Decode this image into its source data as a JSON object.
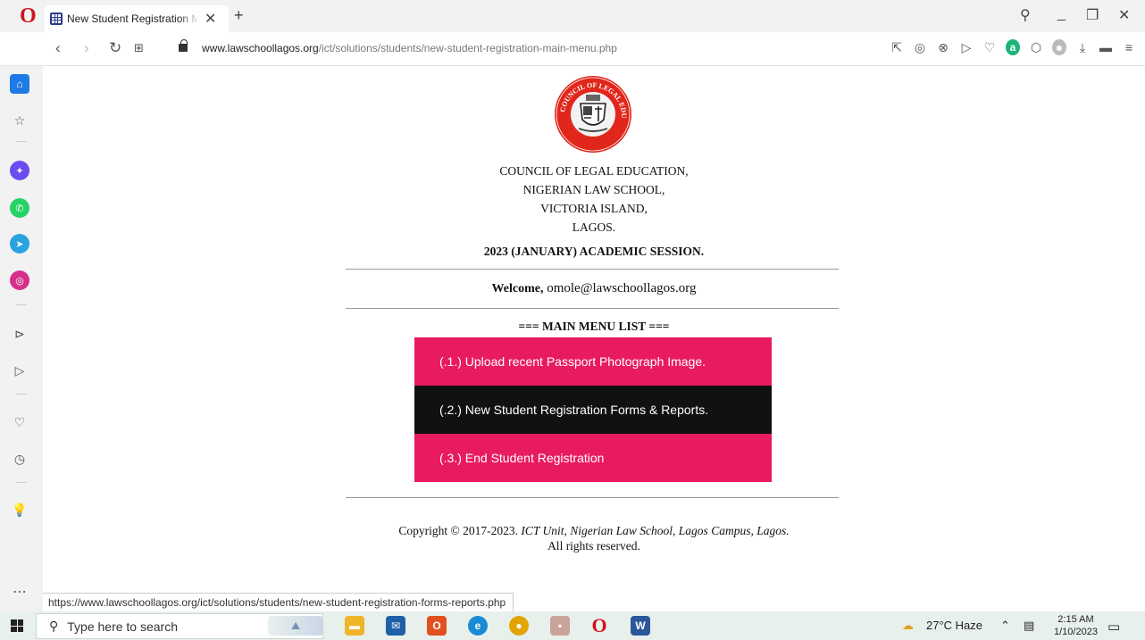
{
  "browser": {
    "tab_title": "New Student Registration Main Menu",
    "url_domain": "www.lawschoollagos.org",
    "url_path": "/ict/solutions/students/new-student-registration-main-menu.php",
    "status_url": "https://www.lawschoollagos.org/ict/solutions/students/new-student-registration-forms-reports.php"
  },
  "page": {
    "address_lines": [
      "COUNCIL OF LEGAL EDUCATION,",
      "NIGERIAN LAW SCHOOL,",
      "VICTORIA ISLAND,",
      "LAGOS."
    ],
    "session": "2023 (JANUARY) ACADEMIC SESSION.",
    "welcome_label": "Welcome,",
    "welcome_email": "omole@lawschoollagos.org",
    "menu_title": "=== MAIN MENU LIST ===",
    "menu": [
      {
        "label": "(.1.) Upload recent Passport Photograph Image.",
        "color": "#e81b5f"
      },
      {
        "label": "(.2.) New Student Registration Forms & Reports.",
        "color": "#111111"
      },
      {
        "label": "(.3.) End Student Registration",
        "color": "#e81b5f"
      }
    ],
    "footer_prefix": "Copyright © 2017-2023.",
    "footer_italic": "ICT Unit, Nigerian Law School, Lagos Campus, Lagos.",
    "footer_line2": "All rights reserved.",
    "seal_text": "COUNCIL OF LEGAL EDUCATION"
  },
  "taskbar": {
    "search_placeholder": "Type here to search",
    "weather": "27°C  Haze",
    "time": "2:15 AM",
    "date": "1/10/2023"
  }
}
